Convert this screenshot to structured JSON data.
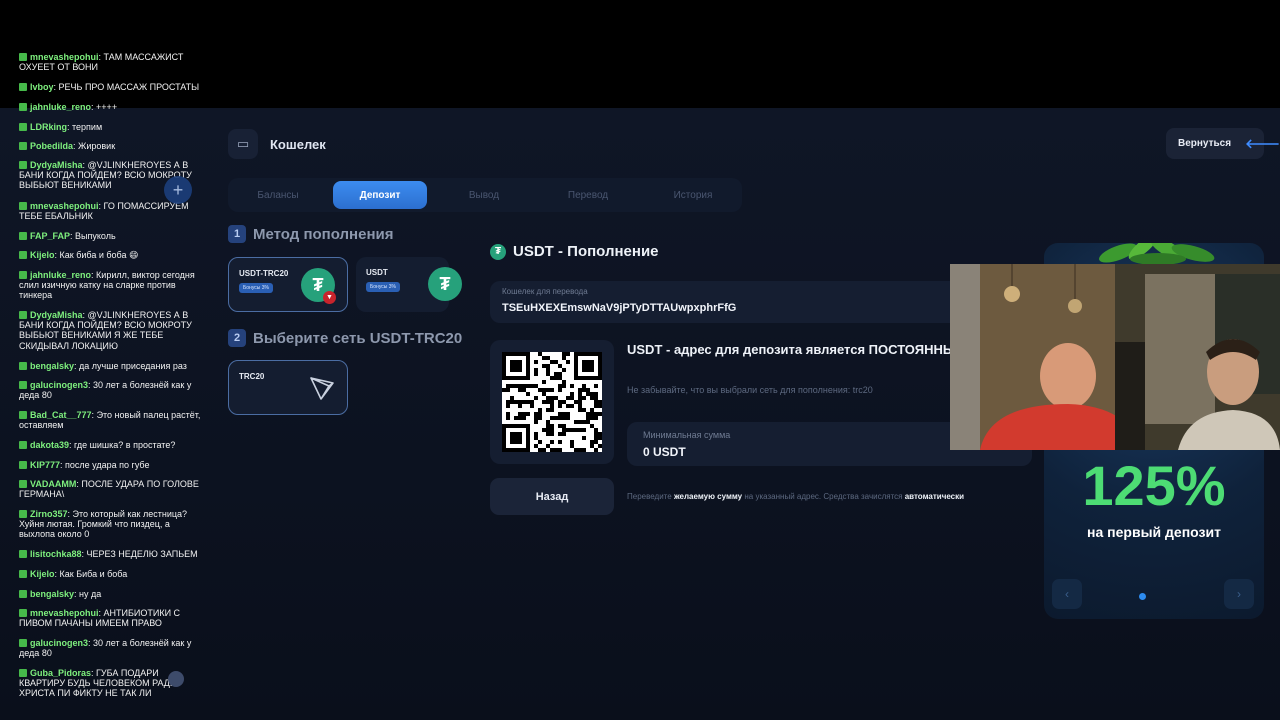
{
  "wallet": {
    "title": "Кошелек",
    "back_label": "Вернуться"
  },
  "tabs": [
    {
      "label": "Балансы",
      "active": false
    },
    {
      "label": "Депозит",
      "active": true
    },
    {
      "label": "Вывод",
      "active": false
    },
    {
      "label": "Перевод",
      "active": false
    },
    {
      "label": "История",
      "active": false
    }
  ],
  "step1": {
    "num": "1",
    "title": "Метод пополнения"
  },
  "step2": {
    "num": "2",
    "title": "Выберите сеть USDT-TRC20"
  },
  "methods": [
    {
      "name": "USDT-TRC20",
      "bonus": "Бонусы 3%",
      "selected": true
    },
    {
      "name": "USDT",
      "bonus": "Бонусы 3%",
      "selected": false
    }
  ],
  "network": {
    "name": "TRC20"
  },
  "deposit": {
    "title": "USDT - Пополнение",
    "wallet_label": "Кошелек для перевода",
    "wallet_address": "TSEuHXEXEmswNaV9jPTyDTTAUwpxphrFfG",
    "permanent_text": "USDT - адрес для депозита является ПОСТОЯННЫМ",
    "note": "Не забывайте, что вы выбрали сеть для пополнения: trc20",
    "min_label": "Минимальная сумма",
    "min_value": "0 USDT",
    "back_button": "Назад",
    "footer_pre": "Переведите",
    "footer_b1": "желаемую сумму",
    "footer_mid": "на указанный адрес. Средства зачислятся",
    "footer_b2": "автоматически"
  },
  "promo": {
    "percent": "125%",
    "subtitle": "на первый депозит"
  },
  "chat": [
    {
      "user": "mnevashepohui",
      "text": "ТАМ МАССАЖИСТ ОХУЕЕТ ОТ ВОНИ"
    },
    {
      "user": "lvboy",
      "text": "РЕЧЬ ПРО МАССАЖ ПРОСТАТЫ"
    },
    {
      "user": "jahnluke_reno",
      "text": "++++"
    },
    {
      "user": "LDRking",
      "text": "терпим"
    },
    {
      "user": "Pobedilda",
      "text": "Жировик"
    },
    {
      "user": "DydyaMisha",
      "text": "@VJLINKHEROYES А В БАНИ КОГДА ПОЙДЕМ? ВСЮ МОКРОТУ ВЫБЬЮТ ВЕНИКАМИ"
    },
    {
      "user": "mnevashepohui",
      "text": "ГО ПОМАССИРУЕМ ТЕБЕ ЕБАЛЬНИК"
    },
    {
      "user": "FAP_FAP",
      "text": "Выпуколь"
    },
    {
      "user": "Kijelo",
      "text": "Как биба и боба 😄"
    },
    {
      "user": "jahnluke_reno",
      "text": "Кирилл, виктор сегодня слил изичную катку на сларке против тинкера"
    },
    {
      "user": "DydyaMisha",
      "text": "@VJLINKHEROYES А В БАНИ КОГДА ПОЙДЕМ? ВСЮ МОКРОТУ ВЫБЬЮТ ВЕНИКАМИ Я ЖЕ ТЕБЕ СКИДЫВАЛ ЛОКАЦИЮ"
    },
    {
      "user": "bengalsky",
      "text": "да лучше приседания раз"
    },
    {
      "user": "galucinogen3",
      "text": "30 лет а болезнёй как у деда 80"
    },
    {
      "user": "Bad_Cat__777",
      "text": "Это новый палец растёт, оставляем"
    },
    {
      "user": "dakota39",
      "text": "где шишка? в простате?"
    },
    {
      "user": "KIP777",
      "text": "после удара по губе"
    },
    {
      "user": "VADAAMM",
      "text": "ПОСЛЕ УДАРА ПО ГОЛОВЕ ГЕРМАНА\\"
    },
    {
      "user": "Zirno357",
      "text": "Это который как лестница? Хуйня лютая. Громкий что пиздец, а выхлопа около 0"
    },
    {
      "user": "lisitochka88",
      "text": "ЧЕРЕЗ НЕДЕЛЮ ЗАПЬЕМ"
    },
    {
      "user": "Kijelo",
      "text": "Как Биба и боба"
    },
    {
      "user": "bengalsky",
      "text": "ну да"
    },
    {
      "user": "mnevashepohui",
      "text": "АНТИБИОТИКИ С ПИВОМ ПАЧАНЫ ИМЕЕМ ПРАВО"
    },
    {
      "user": "galucinogen3",
      "text": "30 лет а болезнёй как у деда 80"
    },
    {
      "user": "Guba_Pidoras",
      "text": "ГУБА ПОДАРИ КВАРТИРУ БУДЬ ЧЕЛОВЕКОМ РАДИ ХРИСТА ПИ ФИКТУ НЕ ТАК ЛИ"
    }
  ],
  "colors": {
    "accent": "#3c8cf0",
    "promo_green": "#4ddc74",
    "tether_green": "#26a17b",
    "chat_user": "#7ef07e"
  }
}
